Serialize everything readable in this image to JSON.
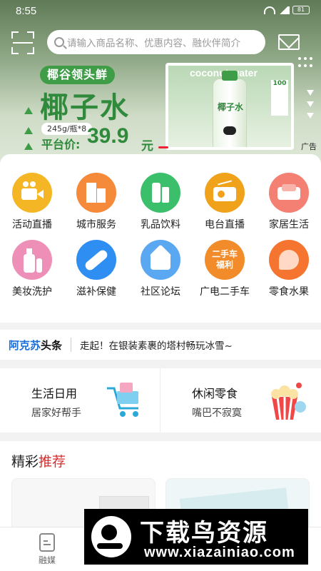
{
  "status_bar": {
    "time": "8:55",
    "battery": "81"
  },
  "search": {
    "placeholder": "请输入商品名称、优惠内容、融伙伴简介"
  },
  "banner": {
    "tag": "椰谷领头鲜",
    "title": "椰子水",
    "spec": "245g/瓶*8",
    "price_label": "平台价:",
    "price": "39.9",
    "price_unit": "元",
    "product_brand": "coconut water",
    "bottle_label": "椰子水",
    "box_text": "100",
    "ad_label": "广告"
  },
  "categories": [
    {
      "label": "活动直播",
      "icon": "video-camera-icon",
      "color": "#f5b625"
    },
    {
      "label": "城市服务",
      "icon": "building-icon",
      "color": "#f58a3a"
    },
    {
      "label": "乳品饮料",
      "icon": "drink-icon",
      "color": "#3cbf6a"
    },
    {
      "label": "电台直播",
      "icon": "radio-icon",
      "color": "#f0a21a"
    },
    {
      "label": "家居生活",
      "icon": "sofa-icon",
      "color": "#f47f73"
    },
    {
      "label": "美妆洗护",
      "icon": "lotion-bottle-icon",
      "color": "#ee8fb8"
    },
    {
      "label": "滋补保健",
      "icon": "capsule-icon",
      "color": "#2f8ef1"
    },
    {
      "label": "社区论坛",
      "icon": "house-face-icon",
      "color": "#5aa7f2"
    },
    {
      "label": "广电二手车",
      "icon": "secondhand-car-badge-icon",
      "color": "#f28b2a",
      "badge": "二手车福利"
    },
    {
      "label": "零食水果",
      "icon": "peach-icon",
      "color": "#f5742f"
    }
  ],
  "headline": {
    "brand_blue": "阿克苏",
    "brand_black": "头条",
    "news": "走起！在银装素裹的塔村畅玩冰雪~"
  },
  "promos": [
    {
      "title": "生活日用",
      "subtitle": "居家好帮手",
      "icon": "shopping-cart-icon"
    },
    {
      "title": "休闲零食",
      "subtitle": "嘴巴不寂寞",
      "icon": "popcorn-icon"
    }
  ],
  "recommend": {
    "title_black": "精彩",
    "title_red": "推荐"
  },
  "tabbar": {
    "tabs": [
      {
        "label": "融媒",
        "icon": "media-icon"
      }
    ]
  },
  "watermark": {
    "title": "下载鸟资源",
    "url": "www.xiazainiao.com"
  },
  "colors": {
    "brand_green": "#3f9c47",
    "accent_red": "#d32f2f",
    "headline_blue": "#1d6fd6"
  }
}
